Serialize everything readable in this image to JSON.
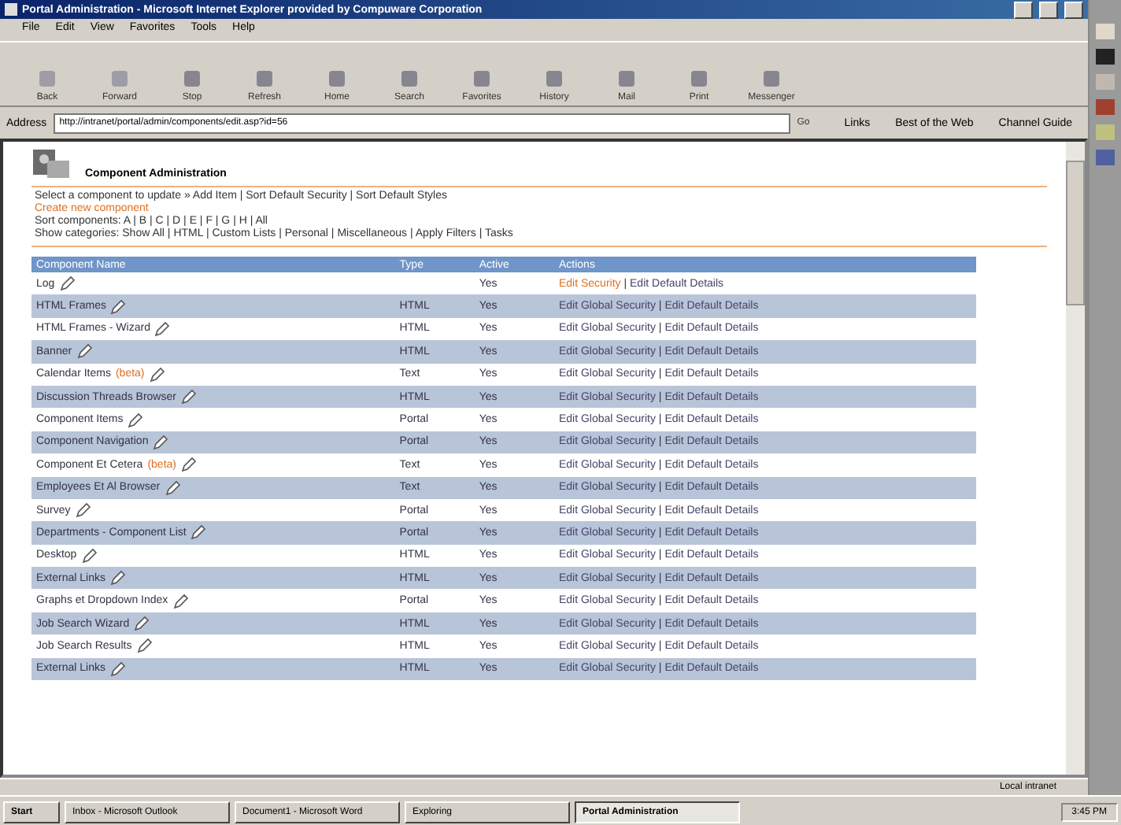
{
  "window": {
    "title": "Portal Administration - Microsoft Internet Explorer provided by Compuware Corporation"
  },
  "menu": [
    "File",
    "Edit",
    "View",
    "Favorites",
    "Tools",
    "Help"
  ],
  "toolbar": [
    "Back",
    "Forward",
    "Stop",
    "Refresh",
    "Home",
    "Search",
    "Favorites",
    "History",
    "Mail",
    "Print",
    "Messenger"
  ],
  "address": {
    "label": "Address",
    "value": "http://intranet/portal/admin/components/edit.asp?id=56",
    "go": "Go",
    "links": [
      "Links",
      "Best of the Web",
      "Channel Guide"
    ]
  },
  "page": {
    "heading": "Component Administration",
    "intro": [
      {
        "text": "Select a component to update » Add Item | Sort Default Security | Sort Default Styles",
        "highlight": false
      },
      {
        "text": "Create new component",
        "highlight": true
      },
      {
        "text": "Sort components: A | B | C | D | E | F | G | H | All",
        "highlight": false
      },
      {
        "text": "Show categories: Show All | HTML | Custom Lists | Personal | Miscellaneous | Apply Filters | Tasks",
        "highlight": false
      }
    ],
    "columns": [
      "Component Name",
      "Type",
      "Active",
      "Actions"
    ],
    "rows": [
      {
        "name": "Log",
        "tag": "",
        "type": "",
        "active": "Yes",
        "actions": [
          "Edit Security",
          "|",
          "Edit Default Details"
        ],
        "highlight": true
      },
      {
        "name": "HTML Frames",
        "tag": "",
        "type": "HTML",
        "active": "Yes",
        "actions": [
          "Edit Global Security",
          "|",
          "Edit Default Details"
        ],
        "highlight": false
      },
      {
        "name": "HTML Frames - Wizard",
        "tag": "",
        "type": "HTML",
        "active": "Yes",
        "actions": [
          "Edit Global Security",
          "|",
          "Edit Default Details"
        ],
        "highlight": false
      },
      {
        "name": "Banner",
        "tag": "",
        "type": "HTML",
        "active": "Yes",
        "actions": [
          "Edit Global Security",
          "|",
          "Edit Default Details"
        ],
        "highlight": false
      },
      {
        "name": "Calendar Items",
        "tag": "(beta)",
        "type": "Text",
        "active": "Yes",
        "actions": [
          "Edit Global Security",
          "|",
          "Edit Default Details"
        ],
        "highlight": false
      },
      {
        "name": "Discussion Threads Browser",
        "tag": "",
        "type": "HTML",
        "active": "Yes",
        "actions": [
          "Edit Global Security",
          "|",
          "Edit Default Details"
        ],
        "highlight": false
      },
      {
        "name": "Component Items",
        "tag": "",
        "type": "Portal",
        "active": "Yes",
        "actions": [
          "Edit Global Security",
          "|",
          "Edit Default Details"
        ],
        "highlight": false
      },
      {
        "name": "Component Navigation",
        "tag": "",
        "type": "Portal",
        "active": "Yes",
        "actions": [
          "Edit Global Security",
          "|",
          "Edit Default Details"
        ],
        "highlight": false
      },
      {
        "name": "Component Et Cetera",
        "tag": "(beta)",
        "type": "Text",
        "active": "Yes",
        "actions": [
          "Edit Global Security",
          "|",
          "Edit Default Details"
        ],
        "highlight": false
      },
      {
        "name": "Employees Et Al Browser",
        "tag": "",
        "type": "Text",
        "active": "Yes",
        "actions": [
          "Edit Global Security",
          "|",
          "Edit Default Details"
        ],
        "highlight": false
      },
      {
        "name": "Survey",
        "tag": "",
        "type": "Portal",
        "active": "Yes",
        "actions": [
          "Edit Global Security",
          "|",
          "Edit Default Details"
        ],
        "highlight": false
      },
      {
        "name": "Departments - Component List",
        "tag": "",
        "type": "Portal",
        "active": "Yes",
        "actions": [
          "Edit Global Security",
          "|",
          "Edit Default Details"
        ],
        "highlight": false
      },
      {
        "name": "Desktop",
        "tag": "",
        "type": "HTML",
        "active": "Yes",
        "actions": [
          "Edit Global Security",
          "|",
          "Edit Default Details"
        ],
        "highlight": false
      },
      {
        "name": "External Links",
        "tag": "",
        "type": "HTML",
        "active": "Yes",
        "actions": [
          "Edit Global Security",
          "|",
          "Edit Default Details"
        ],
        "highlight": false
      },
      {
        "name": "Graphs et Dropdown Index",
        "tag": "",
        "type": "Portal",
        "active": "Yes",
        "actions": [
          "Edit Global Security",
          "|",
          "Edit Default Details"
        ],
        "highlight": false
      },
      {
        "name": "Job Search Wizard",
        "tag": "",
        "type": "HTML",
        "active": "Yes",
        "actions": [
          "Edit Global Security",
          "|",
          "Edit Default Details"
        ],
        "highlight": false
      },
      {
        "name": "Job Search Results",
        "tag": "",
        "type": "HTML",
        "active": "Yes",
        "actions": [
          "Edit Global Security",
          "|",
          "Edit Default Details"
        ],
        "highlight": false
      },
      {
        "name": "External Links",
        "tag": "",
        "type": "HTML",
        "active": "Yes",
        "actions": [
          "Edit Global Security",
          "|",
          "Edit Default Details"
        ],
        "highlight": false
      }
    ]
  },
  "status_bar": {
    "zone": "Local intranet"
  },
  "taskbar": {
    "start": "Start",
    "tasks": [
      {
        "label": "Inbox - Microsoft Outlook",
        "selected": false
      },
      {
        "label": "Document1 - Microsoft Word",
        "selected": false
      },
      {
        "label": "Exploring",
        "selected": false
      },
      {
        "label": "Portal Administration",
        "selected": true
      }
    ],
    "clock": "3:45 PM"
  }
}
